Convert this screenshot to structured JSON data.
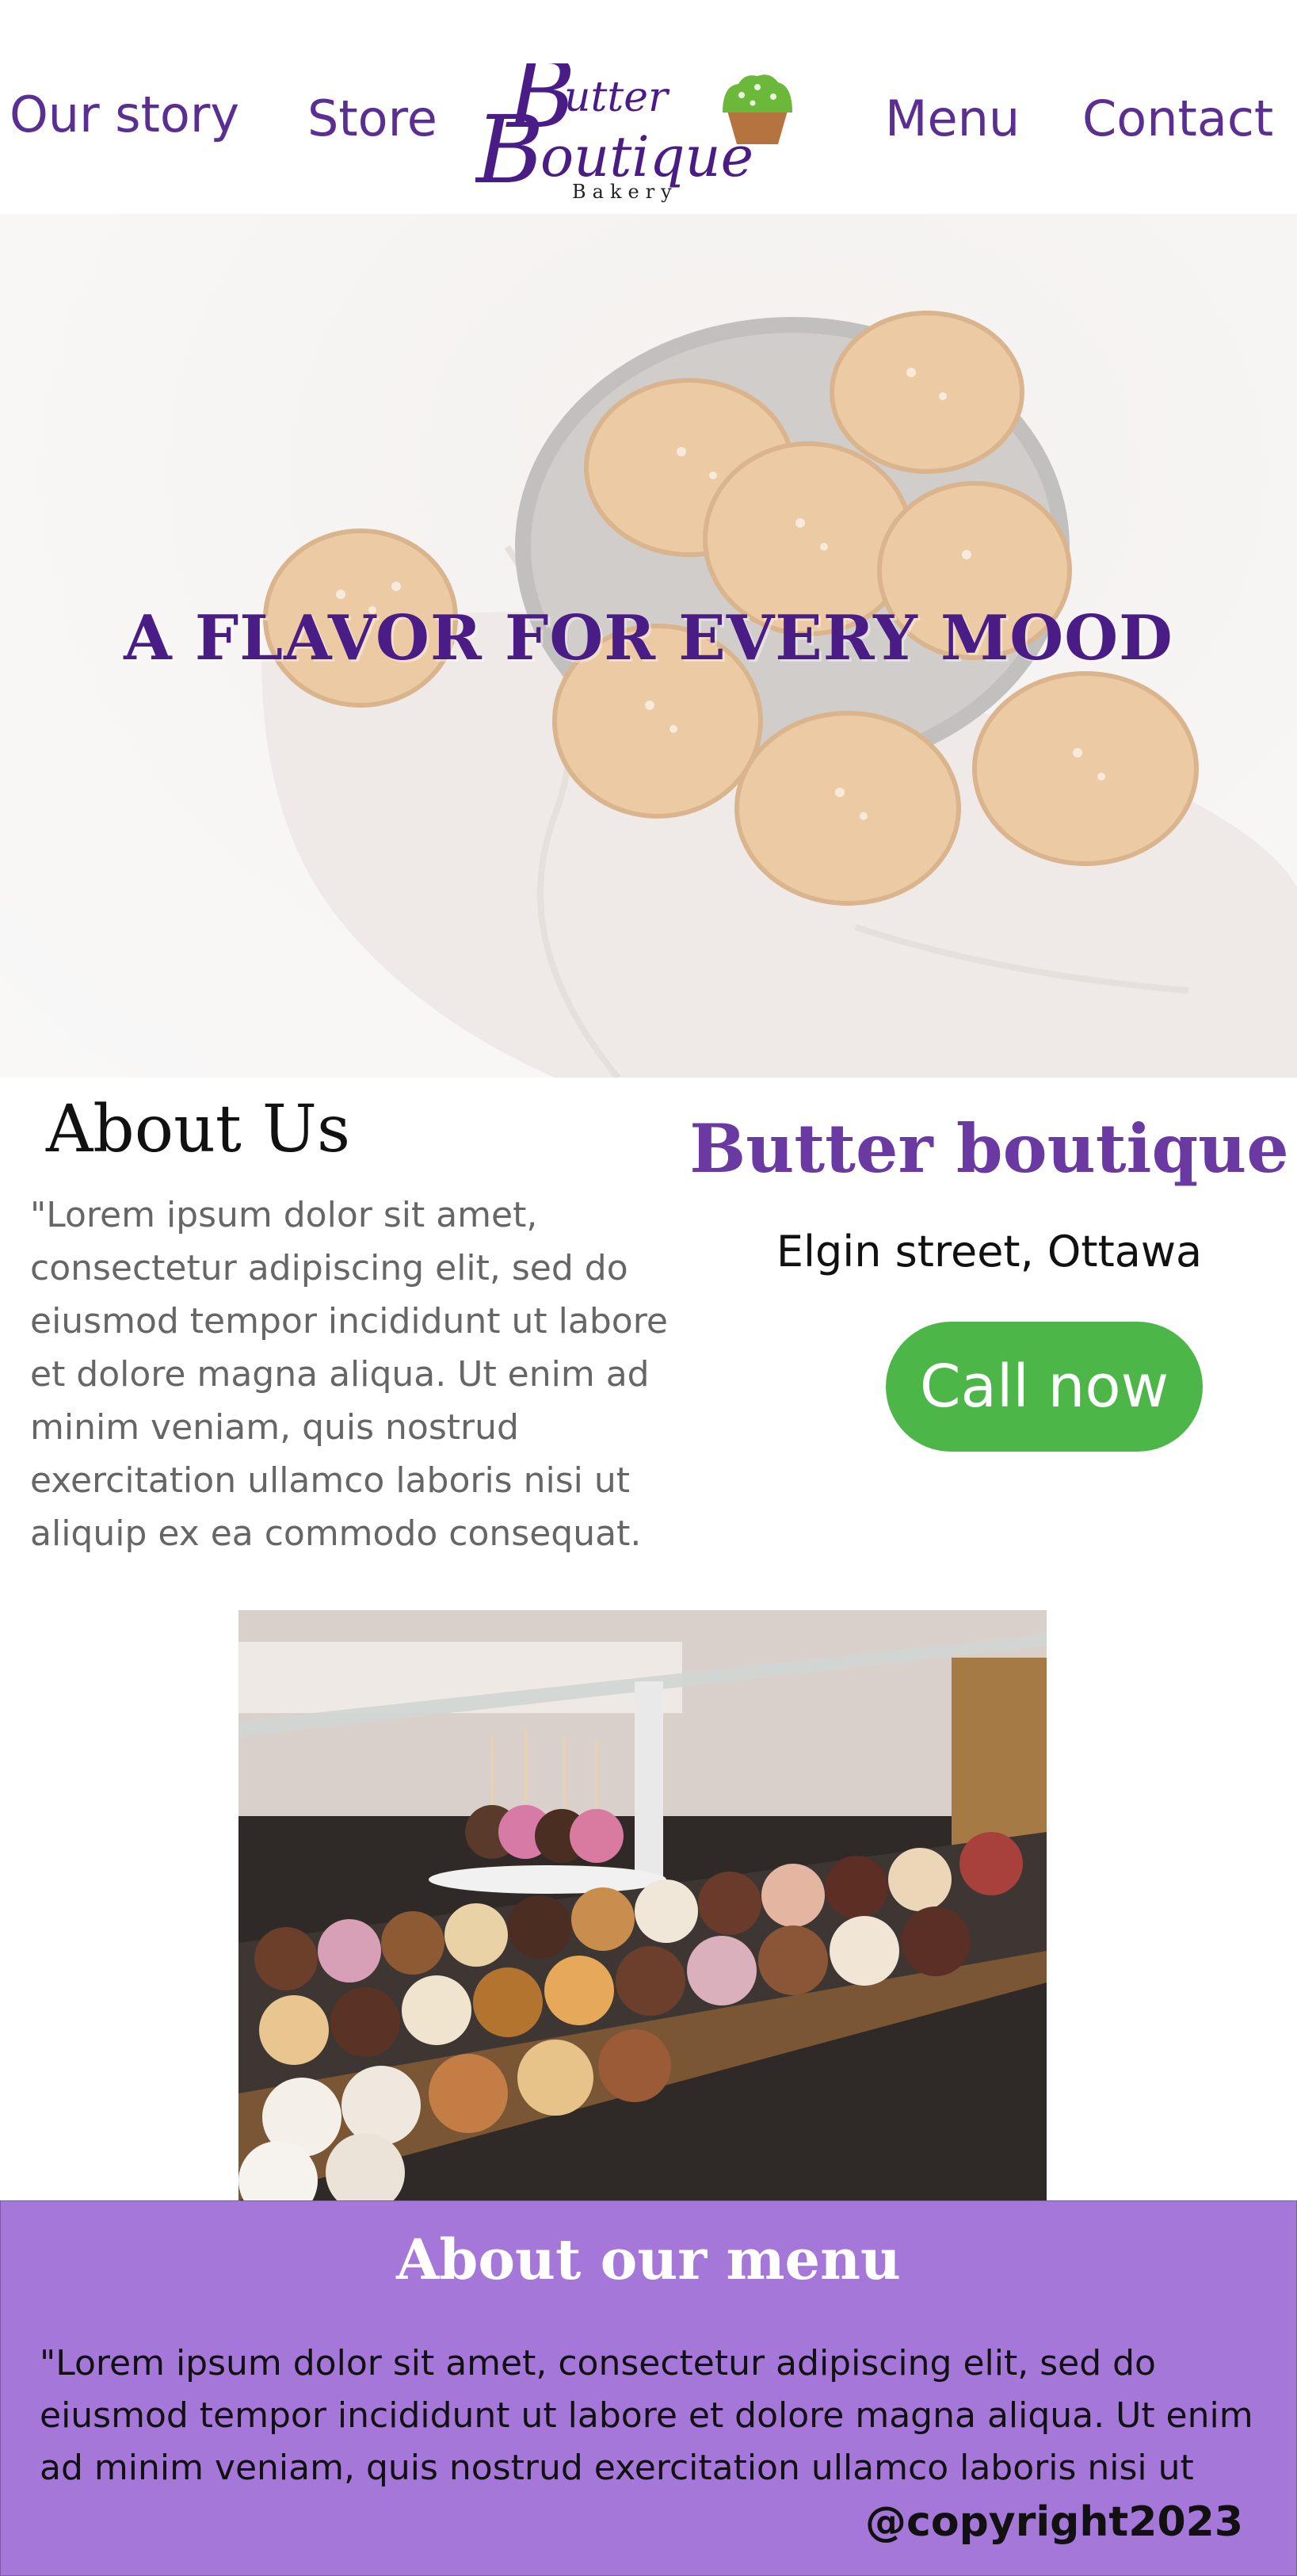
{
  "nav": {
    "links": [
      "Our story",
      "Store",
      "Menu",
      "Contact"
    ]
  },
  "logo": {
    "line1": "Butter",
    "line2": "Boutique",
    "tagline": "Bakery",
    "icon": "cupcake-icon"
  },
  "hero": {
    "headline": "A FLAVOR FOR EVERY MOOD"
  },
  "about": {
    "title": "About Us",
    "text": "\"Lorem ipsum dolor sit amet, consectetur adipiscing elit, sed do eiusmod tempor incididunt ut labore et dolore magna aliqua. Ut enim ad minim veniam, quis nostrud exercitation ullamco laboris nisi ut aliquip ex ea commodo consequat."
  },
  "contact": {
    "brand": "Butter boutique",
    "address": "Elgin street, Ottawa",
    "call_label": "Call now"
  },
  "menu_section": {
    "title": "About our menu",
    "text": "\"Lorem ipsum dolor sit amet, consectetur adipiscing elit, sed do eiusmod tempor incididunt ut labore et dolore magna aliqua. Ut enim ad minim veniam, quis nostrud exercitation ullamco laboris nisi ut"
  },
  "footer": {
    "copyright": "@copyright2023"
  },
  "colors": {
    "brand_purple": "#5b2e91",
    "call_green": "#4cb649",
    "menu_bg": "#a577d8"
  }
}
